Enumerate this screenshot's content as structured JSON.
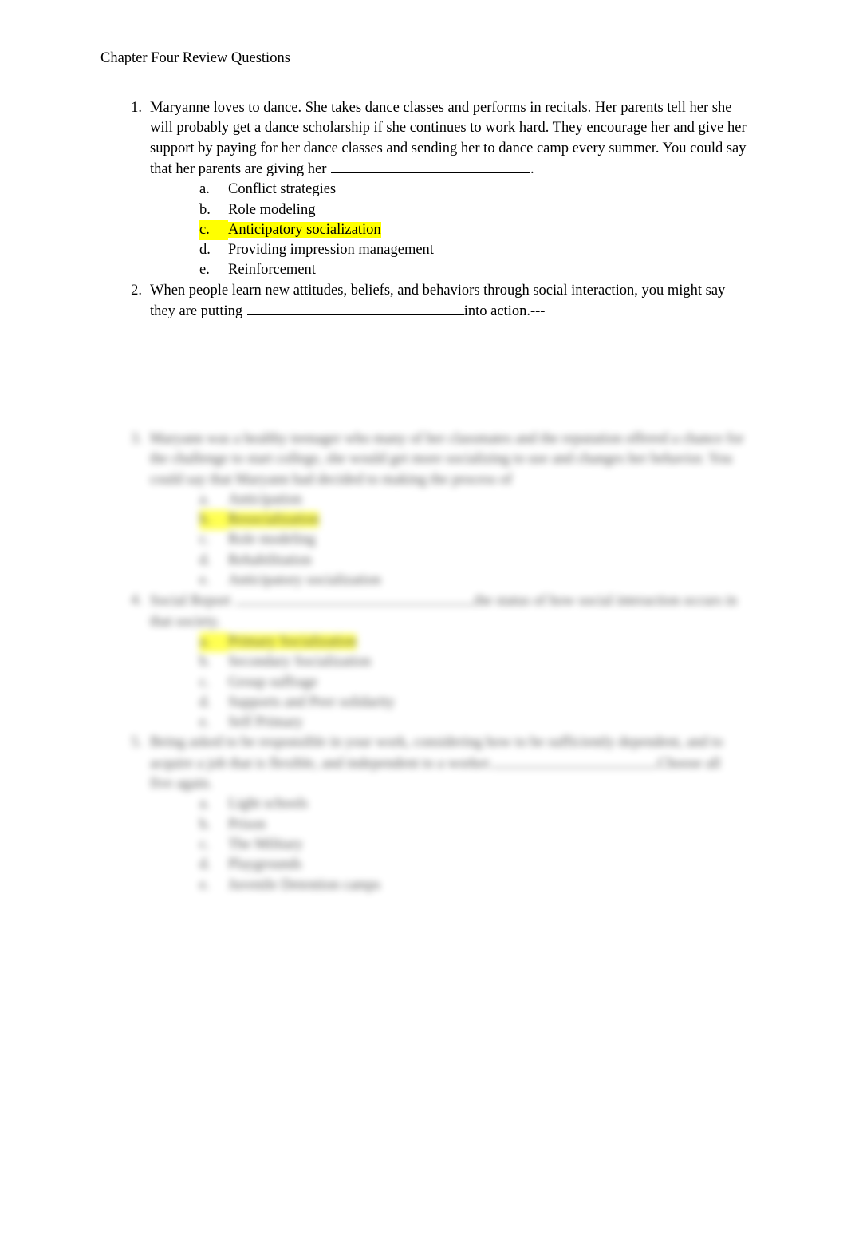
{
  "document": {
    "title": "Chapter Four Review Questions",
    "page_background": "#ffffff",
    "text_color": "#000000",
    "highlight_color": "#ffff00"
  },
  "questions": [
    {
      "number": "1.",
      "text_before_blank": "Maryanne loves to dance.   She takes dance classes and performs in recitals.   Her parents tell her she will probably get a dance scholarship if she continues to work hard.   They encourage her and give her support by paying for her dance classes and sending her to dance camp every summer. You could say that her parents are giving her ",
      "text_after_blank": ".",
      "options": [
        {
          "letter": "a.",
          "label": "Conflict strategies",
          "highlighted": false
        },
        {
          "letter": "b.",
          "label": "Role modeling",
          "highlighted": false
        },
        {
          "letter": "c.",
          "label": "Anticipatory socialization",
          "highlighted": true
        },
        {
          "letter": "d.",
          "label": "Providing impression management",
          "highlighted": false
        },
        {
          "letter": "e.",
          "label": "Reinforcement",
          "highlighted": false
        }
      ]
    },
    {
      "number": "2.",
      "text_before_blank": "When people learn new attitudes, beliefs, and behaviors through social interaction, you might say they are putting ",
      "text_after_blank": "into action.---",
      "options": []
    }
  ],
  "obscured_section": {
    "note": "Lower portion of page is blurred and illegible",
    "questions": [
      {
        "number": "3.",
        "text_before_blank": "Maryann was a healthy teenager who many of her classmates and the reputation offered a chance for the challenge to start college, she would get more socializing to use and changes her behavior. You could say that Maryann had decided to making the process of",
        "text_after_blank": "",
        "options": [
          {
            "letter": "a.",
            "label": "Anticipation",
            "highlighted": false
          },
          {
            "letter": "b.",
            "label": "Resocialization",
            "highlighted": true
          },
          {
            "letter": "c.",
            "label": "Role modeling",
            "highlighted": false
          },
          {
            "letter": "d.",
            "label": "Rehabilitation",
            "highlighted": false
          },
          {
            "letter": "e.",
            "label": "Anticipatory socialization",
            "highlighted": false
          }
        ]
      },
      {
        "number": "4.",
        "text_before_blank": "Social Report ",
        "text_after_blank": "the status of how social interaction occurs in that society.",
        "options": [
          {
            "letter": "a.",
            "label": "Primary Socialization",
            "highlighted": true
          },
          {
            "letter": "b.",
            "label": "Secondary Socialization",
            "highlighted": false
          },
          {
            "letter": "c.",
            "label": "Group suffrage",
            "highlighted": false
          },
          {
            "letter": "d.",
            "label": "Supports and Peer solidarity",
            "highlighted": false
          },
          {
            "letter": "e.",
            "label": "Self Primary",
            "highlighted": false
          }
        ]
      },
      {
        "number": "5.",
        "text_before_blank": "Being asked to be responsible in your work, considering how to be sufficiently dependent, and to acquire a job that is flexible, and independent to a worker",
        "text_after_blank": "Choose all five again.",
        "options": [
          {
            "letter": "a.",
            "label": "Light schools",
            "highlighted": false
          },
          {
            "letter": "b.",
            "label": "Prison",
            "highlighted": false
          },
          {
            "letter": "c.",
            "label": "The Military",
            "highlighted": false
          },
          {
            "letter": "d.",
            "label": "Playgrounds",
            "highlighted": false
          },
          {
            "letter": "e.",
            "label": "Juvenile Detention camps",
            "highlighted": false
          }
        ]
      }
    ]
  }
}
